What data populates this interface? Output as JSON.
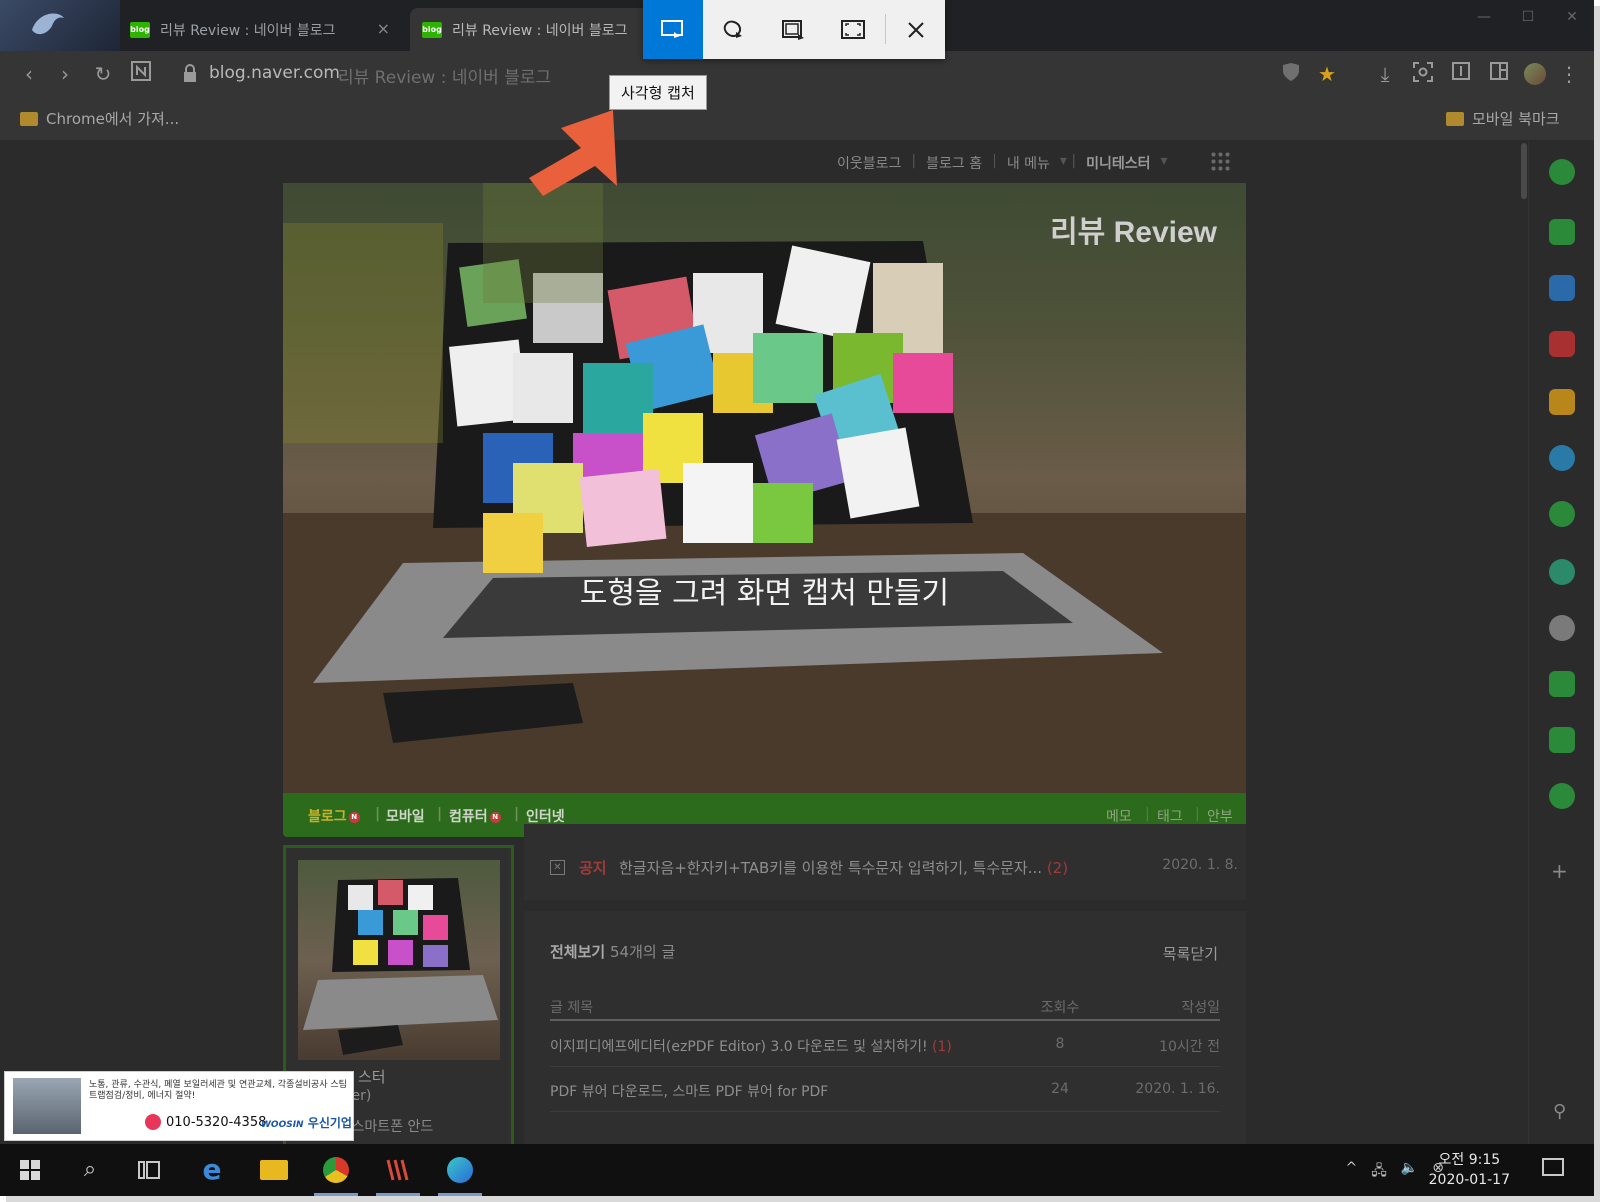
{
  "browser": {
    "tabs": [
      {
        "title": "리뷰 Review : 네이버 블로그",
        "close": "×",
        "favicon": "blog"
      },
      {
        "title": "리뷰 Review : 네이버 블로그",
        "favicon": "blog"
      }
    ],
    "window_controls": {
      "minimize": "—",
      "maximize": "☐",
      "close": "✕"
    },
    "toolbar": {
      "url_host": "blog.naver.com",
      "url_title": "리뷰 Review : 네이버 블로그"
    },
    "bookmarks": {
      "left": "Chrome에서 가져...",
      "right": "모바일 북마크"
    }
  },
  "snip": {
    "tooltip": "사각형 캡처",
    "tools": [
      "rectangle-snip-icon",
      "freeform-snip-icon",
      "window-snip-icon",
      "fullscreen-snip-icon",
      "close-icon"
    ]
  },
  "blog": {
    "top_menu": [
      "이웃블로그",
      "블로그 홈",
      "내 메뉴",
      "미니테스터"
    ],
    "blog_title": "리뷰 Review",
    "hero_caption": "도형을 그려 화면 캡처 만들기",
    "categories": [
      "블로그",
      "모바일",
      "컴퓨터",
      "인터넷"
    ],
    "category_badge": "N",
    "menu_right": [
      "메모",
      "태그",
      "안부"
    ],
    "profile": {
      "name": "스터",
      "sub": "ter)",
      "desc": "PC와 스마트폰 안드"
    },
    "notice": {
      "tag": "공지",
      "title": "한글자음+한자키+TAB키를 이용한 특수문자 입력하기, 특수문자...",
      "count": "(2)",
      "date": "2020. 1. 8."
    },
    "post_list": {
      "heading": "전체보기",
      "count_text": "54개의 글",
      "close_label": "목록닫기",
      "columns": {
        "title": "글 제목",
        "views": "조회수",
        "date": "작성일"
      },
      "rows": [
        {
          "title": "이지피디에프에디터(ezPDF Editor) 3.0 다운로드 및 설치하기!",
          "comments": "(1)",
          "views": "8",
          "date": "10시간 전"
        },
        {
          "title": "PDF 뷰어 다운로드, 스마트 PDF 뷰어 for PDF",
          "comments": "",
          "views": "24",
          "date": "2020. 1. 16."
        }
      ]
    }
  },
  "ad": {
    "text": "노통, 관류, 수관식, 폐열 보일러세관 및 연관교체, 각종설비공사 스팀트랩점검/정비, 에너지 절약!",
    "phone": "010-5320-4358",
    "brand": "우신기업",
    "brand_en": "WOOSIN"
  },
  "taskbar": {
    "apps": [
      "windows-start-icon",
      "search-icon",
      "task-view-icon",
      "edge-icon",
      "file-explorer-icon",
      "chrome-icon",
      "app-icon",
      "whale-icon"
    ],
    "time": "오전 9:15",
    "date": "2020-01-17"
  },
  "colors": {
    "snip_active": "#0078d7",
    "blog_green": "#2d6b1c",
    "arrow": "#e8603c"
  }
}
